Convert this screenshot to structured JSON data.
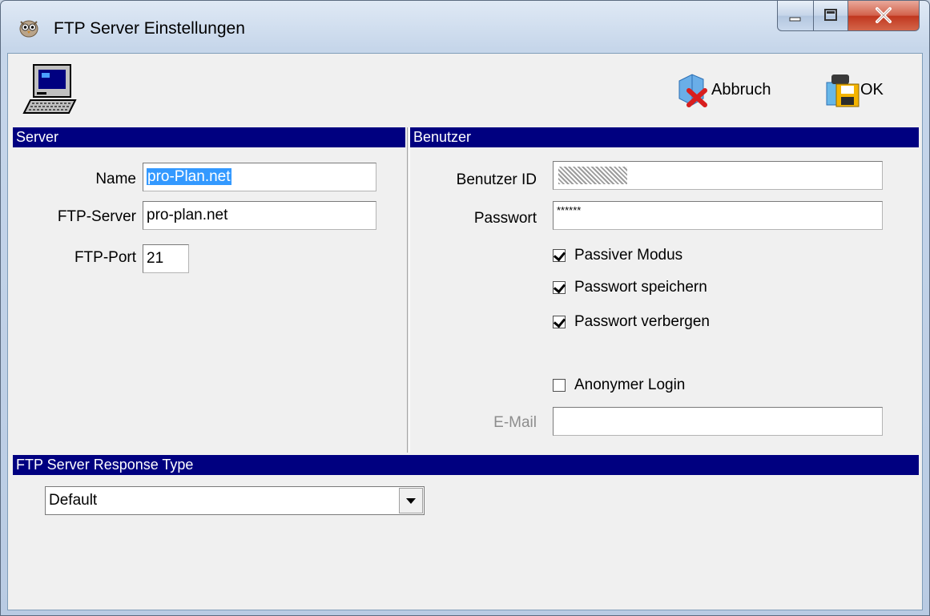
{
  "window": {
    "title": "FTP Server Einstellungen"
  },
  "toolbar": {
    "cancel_label": "Abbruch",
    "ok_label": "OK"
  },
  "server": {
    "header": "Server",
    "name_label": "Name",
    "name_value": "pro-Plan.net",
    "ftp_server_label": "FTP-Server",
    "ftp_server_value": "pro-plan.net",
    "ftp_port_label": "FTP-Port",
    "ftp_port_value": "21"
  },
  "benutzer": {
    "header": "Benutzer",
    "user_id_label": "Benutzer ID",
    "password_label": "Passwort",
    "password_value": "******",
    "checkboxes": [
      {
        "label": "Passiver Modus",
        "checked": true
      },
      {
        "label": "Passwort speichern",
        "checked": true
      },
      {
        "label": "Passwort verbergen",
        "checked": true
      },
      {
        "label": "Anonymer Login",
        "checked": false
      }
    ],
    "email_label": "E-Mail",
    "email_value": ""
  },
  "response": {
    "header": "FTP Server Response Type",
    "selected": "Default"
  },
  "icons": {
    "app": "owl-icon",
    "computer": "computer-icon",
    "cancel": "cancel-x-icon",
    "ok": "save-disk-icon"
  }
}
